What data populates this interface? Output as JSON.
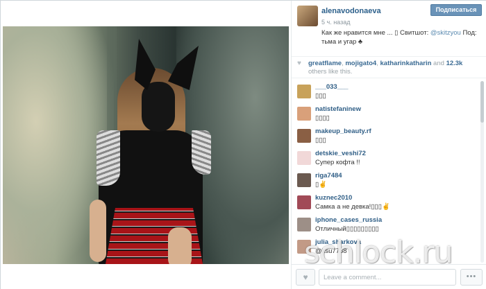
{
  "post": {
    "owner": "alenavodonaeva",
    "time": "5 ч. назад",
    "caption_prefix": "Как же нравится мне ... ",
    "caption_glyph": "▯",
    "caption_mid": " Свитшот: ",
    "caption_mention": "@skitzyou",
    "caption_suffix": " Под: тьма и угар ♣",
    "follow_label": "Подписаться"
  },
  "likes": {
    "names": [
      "greatflame",
      "mojigato4",
      "katharinkatharin"
    ],
    "sep1": ", ",
    "sep2": ", ",
    "sep3": " and ",
    "count": "12.3k",
    "suffix": " others like this."
  },
  "comments": [
    {
      "user": "___033___",
      "text": "▯▯▯",
      "avatar_color": "#c8a25a"
    },
    {
      "user": "natistefaninew",
      "text": "▯▯▯▯",
      "avatar_color": "#d9a07a"
    },
    {
      "user": "makeup_beauty.rf",
      "text": "▯▯▯",
      "avatar_color": "#8a5f44"
    },
    {
      "user": "detskie_veshi72",
      "text": "Супер кофта !!",
      "avatar_color": "#f1d8d8"
    },
    {
      "user": "riga7484",
      "text": "▯✌",
      "avatar_color": "#6b5a50"
    },
    {
      "user": "kuznec2010",
      "text": "Самка а не девка!▯▯▯✌",
      "avatar_color": "#a14a57"
    },
    {
      "user": "iphone_cases_russia",
      "text": "Отличный▯▯▯▯▯▯▯▯▯",
      "avatar_color": "#9d8f87"
    },
    {
      "user": "julia_sharkova",
      "text": "@ksu7788",
      "avatar_color": "#c29a86"
    }
  ],
  "footer": {
    "placeholder": "Leave a comment...",
    "more_label": "•••",
    "heart_glyph": "♥"
  },
  "watermark": "schlock.ru"
}
